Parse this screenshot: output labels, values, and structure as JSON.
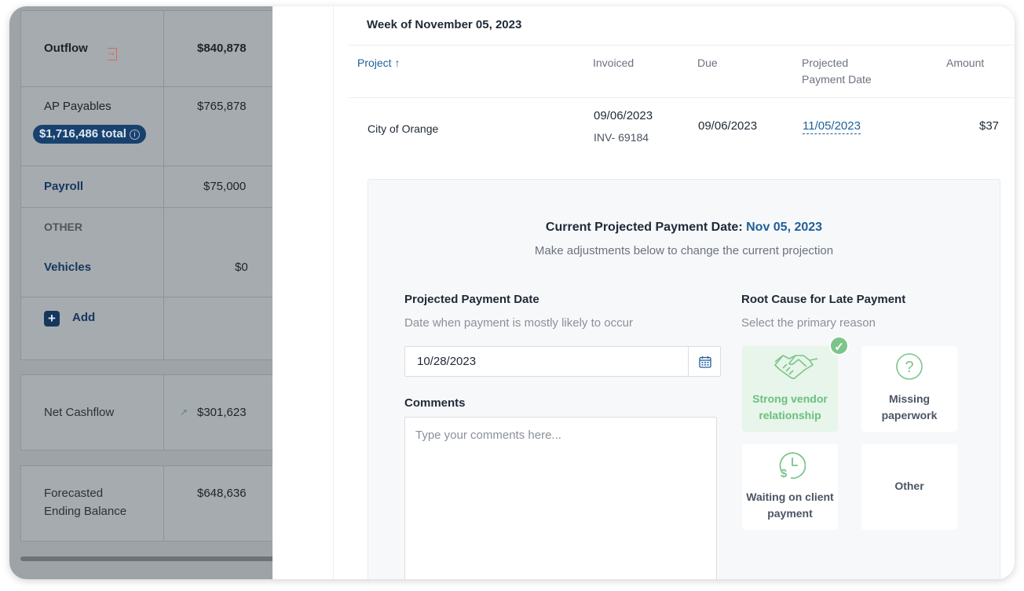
{
  "left_panel": {
    "outflow": {
      "label": "Outflow",
      "value": "$840,878"
    },
    "ap_payables": {
      "label": "AP Payables",
      "value": "$765,878",
      "total_badge": "$1,716,486 total",
      "info_glyph": "i"
    },
    "payroll": {
      "label": "Payroll",
      "value": "$75,000"
    },
    "other_heading": "OTHER",
    "vehicles": {
      "label": "Vehicles",
      "value": "$0"
    },
    "add": {
      "icon_glyph": "+",
      "label": "Add"
    },
    "net_cashflow": {
      "label": "Net Cashflow",
      "value": "$301,623",
      "trend_glyph": "↗"
    },
    "forecasted": {
      "label_line1": "Forecasted",
      "label_line2": "Ending Balance",
      "value": "$648,636"
    }
  },
  "modal": {
    "week_title": "Week of November 05, 2023",
    "table": {
      "headers": {
        "project": "Project",
        "sort_glyph": "↑",
        "invoiced": "Invoiced",
        "due": "Due",
        "projected_line1": "Projected",
        "projected_line2": "Payment Date",
        "amount": "Amount"
      },
      "row": {
        "project": "City of Orange",
        "invoiced_date": "09/06/2023",
        "invoice_number": "INV- 69184",
        "due": "09/06/2023",
        "projected": "11/05/2023",
        "amount": "$37"
      }
    },
    "adjust": {
      "current_label": "Current Projected Payment Date:",
      "current_value": "Nov 05, 2023",
      "subtitle": "Make adjustments below to change the current projection",
      "date_field": {
        "label": "Projected Payment Date",
        "hint": "Date when payment is mostly likely to occur",
        "value": "10/28/2023"
      },
      "comments": {
        "label": "Comments",
        "placeholder": "Type your comments here..."
      },
      "root_cause": {
        "label": "Root Cause for Late Payment",
        "hint": "Select the primary reason",
        "check_glyph": "✓",
        "options": [
          {
            "line1": "Strong vendor",
            "line2": "relationship",
            "selected": true,
            "icon": "handshake-icon"
          },
          {
            "line1": "Missing",
            "line2": "paperwork",
            "selected": false,
            "icon": "question-icon",
            "glyph": "?"
          },
          {
            "line1": "Waiting on client",
            "line2": "payment",
            "selected": false,
            "icon": "clock-dollar-icon",
            "glyph": "$"
          },
          {
            "line1": "Other",
            "selected": false
          }
        ]
      }
    }
  },
  "colors": {
    "accent": "#1f5f99",
    "selected_green": "#6bbf7c",
    "overlay": "#9ea3a8",
    "outflow_icon": "#d8655e"
  }
}
